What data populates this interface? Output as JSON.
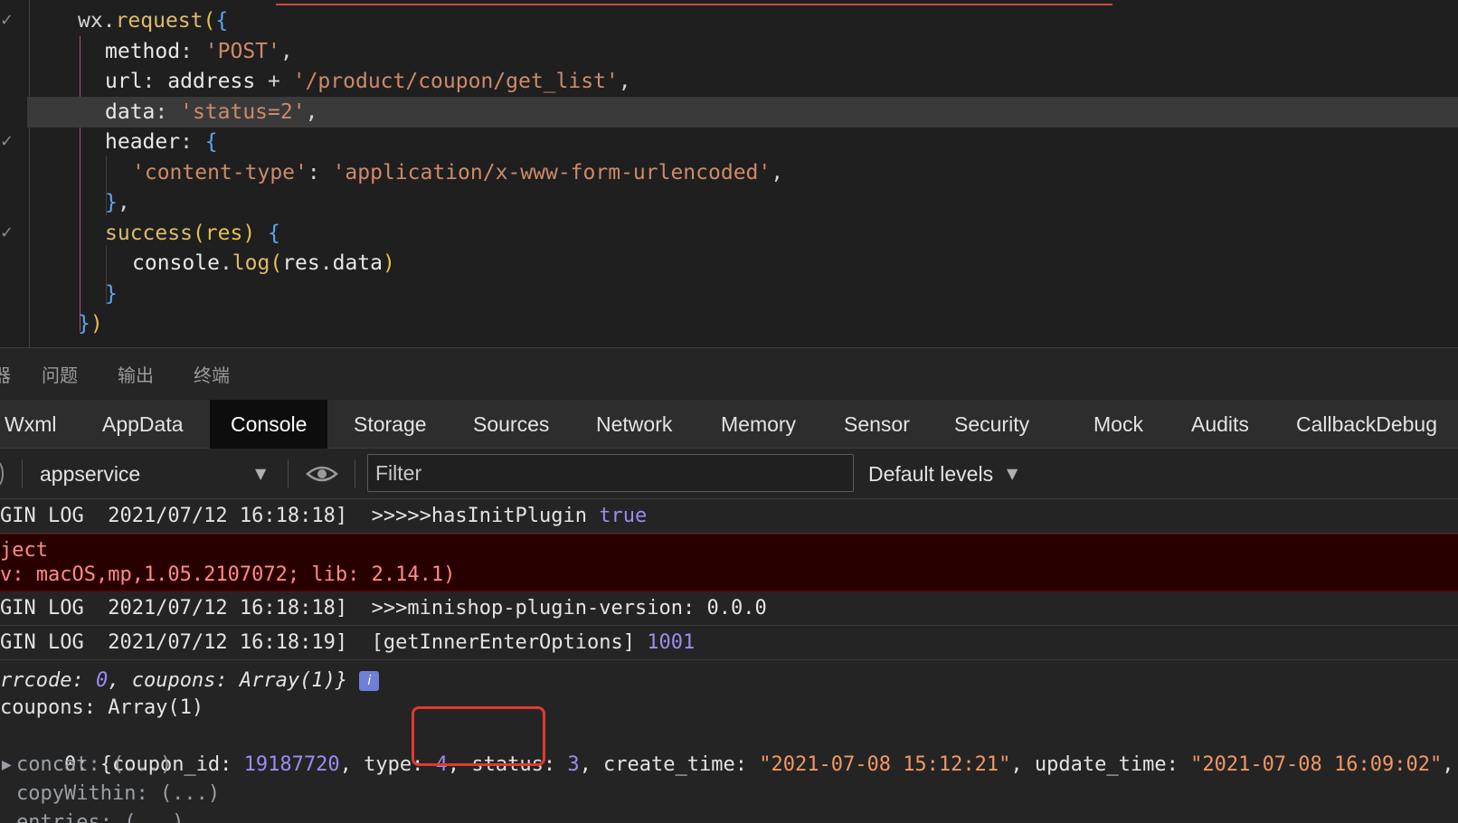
{
  "editor": {
    "lines": [
      {
        "tokens": [
          [
            "t-plain",
            "wx"
          ],
          [
            "t-punct",
            "."
          ],
          [
            "t-fn",
            "request"
          ],
          [
            "t-brace-y",
            "("
          ],
          [
            "t-brace-b",
            "{"
          ]
        ]
      },
      {
        "tokens": [
          [
            "t-prop",
            "method"
          ],
          [
            "t-punct",
            ": "
          ],
          [
            "t-str",
            "'POST'"
          ],
          [
            "t-punct",
            ","
          ]
        ]
      },
      {
        "tokens": [
          [
            "t-prop",
            "url"
          ],
          [
            "t-punct",
            ": "
          ],
          [
            "t-prop",
            "address"
          ],
          [
            "t-op",
            " + "
          ],
          [
            "t-str",
            "'/product/coupon/get_list'"
          ],
          [
            "t-punct",
            ","
          ]
        ]
      },
      {
        "tokens": [
          [
            "t-prop",
            "data"
          ],
          [
            "t-punct",
            ": "
          ],
          [
            "t-str",
            "'status=2'"
          ],
          [
            "t-punct",
            ","
          ]
        ]
      },
      {
        "tokens": [
          [
            "t-prop",
            "header"
          ],
          [
            "t-punct",
            ": "
          ],
          [
            "t-brace-b",
            "{"
          ]
        ]
      },
      {
        "tokens": [
          [
            "t-str",
            "'content-type'"
          ],
          [
            "t-punct",
            ": "
          ],
          [
            "t-str",
            "'application/x-www-form-urlencoded'"
          ],
          [
            "t-punct",
            ","
          ]
        ]
      },
      {
        "tokens": [
          [
            "t-brace-b",
            "}"
          ],
          [
            "t-punct",
            ","
          ]
        ]
      },
      {
        "tokens": [
          [
            "t-fn",
            "success"
          ],
          [
            "t-brace-y",
            "("
          ],
          [
            "t-param",
            "res"
          ],
          [
            "t-brace-y",
            ")"
          ],
          [
            "t-punct",
            " "
          ],
          [
            "t-brace-b",
            "{"
          ]
        ]
      },
      {
        "tokens": [
          [
            "t-prop",
            "console"
          ],
          [
            "t-punct",
            "."
          ],
          [
            "t-fn",
            "log"
          ],
          [
            "t-brace-y",
            "("
          ],
          [
            "t-prop",
            "res"
          ],
          [
            "t-punct",
            "."
          ],
          [
            "t-prop",
            "data"
          ],
          [
            "t-brace-y",
            ")"
          ]
        ]
      },
      {
        "tokens": [
          [
            "t-brace-b",
            "}"
          ]
        ]
      },
      {
        "tokens": [
          [
            "t-brace-b",
            "}"
          ],
          [
            "t-brace-y",
            ")"
          ]
        ]
      }
    ]
  },
  "panel_tabs": [
    "器",
    "问题",
    "输出",
    "终端"
  ],
  "dev_tabs": [
    "Wxml",
    "AppData",
    "Console",
    "Storage",
    "Sources",
    "Network",
    "Memory",
    "Sensor",
    "Security",
    "Mock",
    "Audits",
    "CallbackDebug"
  ],
  "dev_tabs_active": "Console",
  "toolbar": {
    "context": "appservice",
    "filter_placeholder": "Filter",
    "levels": "Default levels"
  },
  "console": {
    "log1_prefix": "GIN LOG  2021/07/12 16:18:18]  >>>>>hasInitPlugin ",
    "log1_value": "true",
    "error_line1": "ject",
    "error_line2": "v: macOS,mp,1.05.2107072; lib: 2.14.1)",
    "log2": "GIN LOG  2021/07/12 16:18:18]  >>>minishop-plugin-version: 0.0.0",
    "log3_prefix": "GIN LOG  2021/07/12 16:18:19]  [getInnerEnterOptions] ",
    "log3_value": "1001",
    "obj_prefix": "rrcode: ",
    "obj_errcode": "0",
    "obj_suffix": ", coupons: Array(1)}",
    "info_badge": "i",
    "coupons_line": "coupons: Array(1)",
    "item_index": "0: {coupon_id: ",
    "coupon_id": "19187720",
    "type_label": ", type: ",
    "type_value": "4",
    "status_label": ", status: ",
    "status_value": "3",
    "create_label": ", create_time: ",
    "create_value": "\"2021-07-08 15:12:21\"",
    "update_label": ", update_time: ",
    "update_value": "\"2021-07-08 16:09:02\"",
    "item_tail": ", …}",
    "concat": "concat: (...)",
    "copyWithin": "copyWithin: (...)",
    "entries": "entries: (...)"
  }
}
